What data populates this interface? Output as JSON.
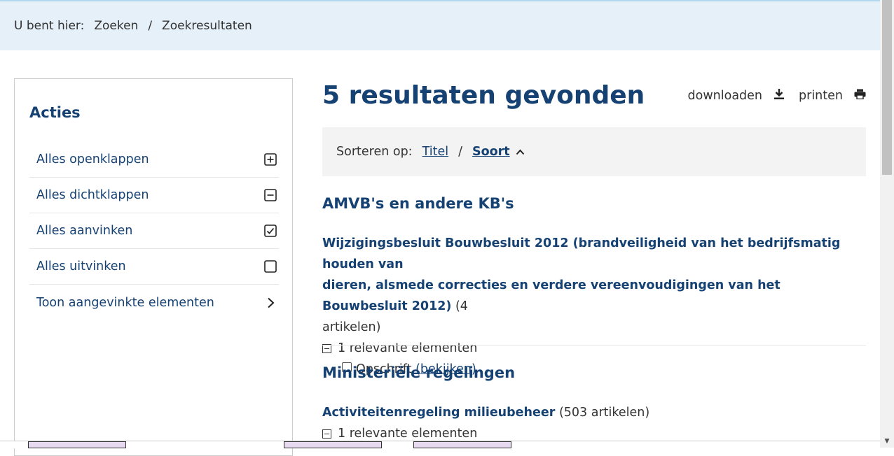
{
  "breadcrumb": {
    "lead": "U bent hier:",
    "items": [
      "Zoeken",
      "Zoekresultaten"
    ],
    "separator": "/"
  },
  "sidebar": {
    "title": "Acties",
    "actions": [
      {
        "label": "Alles openklappen",
        "icon": "plus-square-icon"
      },
      {
        "label": "Alles dichtklappen",
        "icon": "minus-square-icon"
      },
      {
        "label": "Alles aanvinken",
        "icon": "checked-square-icon"
      },
      {
        "label": "Alles uitvinken",
        "icon": "empty-square-icon"
      },
      {
        "label": "Toon aangevinkte elementen",
        "icon": "chevron-right-icon"
      }
    ]
  },
  "main": {
    "heading": "5 resultaten gevonden",
    "tools": {
      "download": "downloaden",
      "print": "printen"
    },
    "sort": {
      "lead": "Sorteren op:",
      "options": [
        "Titel",
        "Soort"
      ],
      "separator": "/",
      "active": "Soort"
    },
    "sections": [
      {
        "heading": "AMVB's en andere KB's",
        "result": {
          "title_line1": "Wijzigingsbesluit Bouwbesluit 2012 (brandveiligheid van het bedrijfsmatig houden van",
          "title_line2": "dieren, alsmede correcties en verdere vereenvoudigingen van het Bouwbesluit 2012)",
          "count_part1": " (4",
          "count_part2": "artikelen)",
          "relevant": "1 relevante elementen",
          "element": "Opschrift",
          "view_link": "(bekijken)"
        }
      },
      {
        "heading": "Ministeriële regelingen",
        "result": {
          "title": "Activiteitenregeling milieubeheer",
          "count": " (503 artikelen)",
          "relevant": "1 relevante elementen"
        }
      }
    ]
  },
  "colors": {
    "brand": "#154273",
    "breadcrumb_bg": "#e5f0f9",
    "sort_bg": "#f3f3f3"
  }
}
